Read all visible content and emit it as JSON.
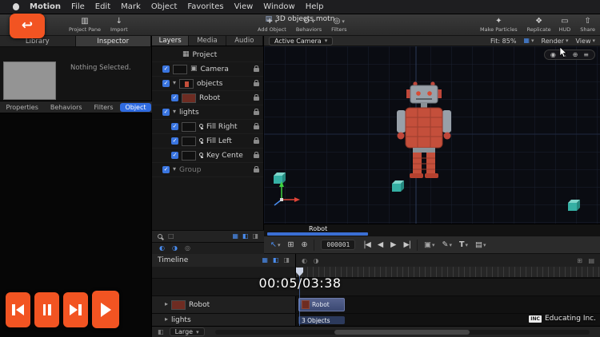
{
  "menubar": {
    "items": [
      "Motion",
      "File",
      "Edit",
      "Mark",
      "Object",
      "Favorites",
      "View",
      "Window",
      "Help"
    ]
  },
  "titlebar": {
    "document_title": "3D objects.motn"
  },
  "toolbar": {
    "project_pane": "Project Pane",
    "import": "Import",
    "add_object": "Add Object",
    "behaviors": "Behaviors",
    "filters": "Filters",
    "make_particles": "Make Particles",
    "replicate": "Replicate",
    "hud": "HUD",
    "share": "Share"
  },
  "inspector": {
    "tabs": {
      "library": "Library",
      "inspector": "Inspector"
    },
    "empty_state": "Nothing Selected.",
    "sub_tabs": [
      "Properties",
      "Behaviors",
      "Filters",
      "Object"
    ],
    "active_sub_tab": "Object"
  },
  "layers": {
    "tabs": [
      "Layers",
      "Media",
      "Audio"
    ],
    "active_tab": "Layers",
    "rows": [
      {
        "name": "Project",
        "type": "project"
      },
      {
        "name": "Camera",
        "type": "camera",
        "checked": true
      },
      {
        "name": "objects",
        "type": "group",
        "checked": true
      },
      {
        "name": "Robot",
        "type": "object",
        "checked": true
      },
      {
        "name": "lights",
        "type": "group",
        "checked": true
      },
      {
        "name": "Fill Right",
        "type": "light",
        "checked": true
      },
      {
        "name": "Fill Left",
        "type": "light",
        "checked": true
      },
      {
        "name": "Key Cente",
        "type": "light",
        "checked": true
      },
      {
        "name": "Group",
        "type": "group",
        "checked": true,
        "dimmed": true
      }
    ]
  },
  "canvas": {
    "camera_menu": "Active Camera",
    "fit": "Fit: 85%",
    "render": "Render",
    "view": "View",
    "frame_field": "000001",
    "selected_object": "Robot"
  },
  "timeline": {
    "panel_label": "Timeline",
    "tracks": [
      {
        "name": "Robot",
        "bar_label": "Robot"
      },
      {
        "name": "lights",
        "bar_label": "3 Objects"
      }
    ],
    "zoom_level": "Large"
  },
  "overlay": {
    "timecode": "00:05/03:38",
    "brand": "Educating Inc.",
    "brand_logo": "INC"
  },
  "colors": {
    "accent_blue": "#3a75e0",
    "accent_orange": "#f25422",
    "robot_red": "#c44f3b",
    "cube_teal": "#35b0a4"
  }
}
